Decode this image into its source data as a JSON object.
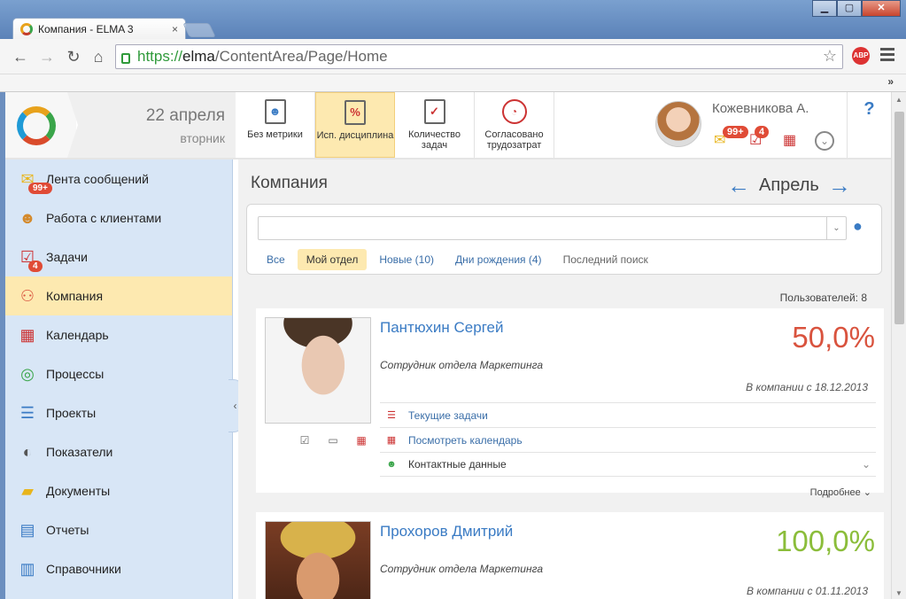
{
  "browser": {
    "tab_title": "Компания - ELMA 3",
    "tab_close": "×",
    "url_scheme": "https://",
    "url_host": "elma",
    "url_path": "/ContentArea/Page/Home",
    "bookmarks_more": "»",
    "win_min": "▁",
    "win_max": "▢",
    "win_close": "✕",
    "abp": "ABP"
  },
  "header": {
    "date_day": "22 апреля",
    "date_weekday": "вторник",
    "metrics": [
      {
        "label": "Без метрики",
        "icon": "user-clipboard-icon"
      },
      {
        "label": "Исп. дисциплина",
        "icon": "percent-clipboard-icon",
        "active": true,
        "glyph": "%"
      },
      {
        "label": "Количество задач",
        "icon": "check-clipboard-icon",
        "glyph": "✓"
      },
      {
        "label": "Согласовано трудозатрат",
        "icon": "clock-icon"
      }
    ],
    "user_name": "Кожевникова А.",
    "messages_badge": "99+",
    "tasks_badge": "4",
    "help": "?"
  },
  "sidebar": {
    "items": [
      {
        "label": "Лента сообщений",
        "icon": "envelope-icon",
        "badge": "99+"
      },
      {
        "label": "Работа с клиентами",
        "icon": "client-person-icon"
      },
      {
        "label": "Задачи",
        "icon": "task-clipboard-icon",
        "badge": "4"
      },
      {
        "label": "Компания",
        "icon": "org-chart-icon",
        "active": true
      },
      {
        "label": "Календарь",
        "icon": "calendar-icon"
      },
      {
        "label": "Процессы",
        "icon": "process-icon"
      },
      {
        "label": "Проекты",
        "icon": "project-gantt-icon"
      },
      {
        "label": "Показатели",
        "icon": "gauge-icon"
      },
      {
        "label": "Документы",
        "icon": "folder-icon"
      },
      {
        "label": "Отчеты",
        "icon": "report-chart-icon"
      },
      {
        "label": "Справочники",
        "icon": "reference-book-icon"
      }
    ]
  },
  "main": {
    "title": "Компания",
    "month": "Апрель",
    "filters": [
      {
        "label": "Все"
      },
      {
        "label": "Мой отдел",
        "selected": true
      },
      {
        "label": "Новые (10)"
      },
      {
        "label": "Дни рождения (4)"
      },
      {
        "label": "Последний поиск",
        "muted": true
      }
    ],
    "users_count": "Пользователей: 8",
    "employees": [
      {
        "name": "Пантюхин Сергей",
        "percent": "50,0%",
        "percent_color": "#d9533e",
        "department": "Сотрудник отдела Маркетинга",
        "since": "В компании с 18.12.2013",
        "links": [
          {
            "label": "Текущие задачи",
            "icon": "task-list-icon"
          },
          {
            "label": "Посмотреть календарь",
            "icon": "calendar-icon"
          },
          {
            "label": "Контактные данные",
            "icon": "contact-person-icon"
          }
        ],
        "more": "Подробнее"
      },
      {
        "name": "Прохоров Дмитрий",
        "percent": "100,0%",
        "percent_color": "#8bbd3a",
        "department": "Сотрудник отдела Маркетинга",
        "since": "В компании с 01.11.2013"
      }
    ]
  }
}
